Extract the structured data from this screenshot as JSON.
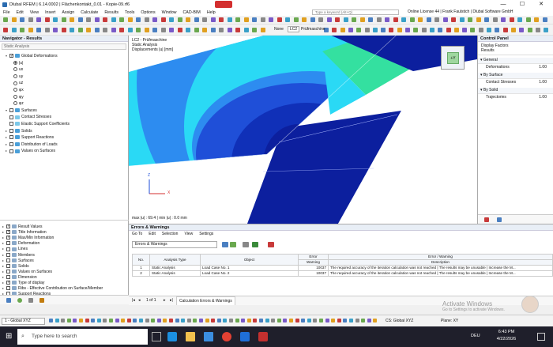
{
  "window": {
    "title": "Dlubal RFEM | 6.14.0002 | Flächenkontakt_0.01 - Kopie-09.rf6",
    "minimize": "—",
    "maximize": "☐",
    "close": "✕"
  },
  "menu": {
    "items": [
      "File",
      "Edit",
      "View",
      "Insert",
      "Assign",
      "Calculate",
      "Results",
      "Tools",
      "Options",
      "Window",
      "CAD-BIM",
      "Help"
    ],
    "search_placeholder": "Type a keyword (Alt+Q)",
    "license": "Online License 44 | Frank Faulstich | Dlubal Software GmbH"
  },
  "toolbar2": {
    "none_label": "None",
    "lc_label": "LC2",
    "lc_name": "Prüfmaschine"
  },
  "navigator": {
    "title": "Navigator - Results",
    "dropdown": "Static Analysis",
    "tree": [
      {
        "label": "Global Deformations",
        "indent": 1,
        "kind": "cb",
        "checked": true,
        "expand": "▾"
      },
      {
        "label": "|u|",
        "indent": 3,
        "kind": "rb",
        "checked": true
      },
      {
        "label": "ux",
        "indent": 3,
        "kind": "rb",
        "checked": false
      },
      {
        "label": "uy",
        "indent": 3,
        "kind": "rb",
        "checked": false
      },
      {
        "label": "uz",
        "indent": 3,
        "kind": "rb",
        "checked": false
      },
      {
        "label": "φx",
        "indent": 3,
        "kind": "rb",
        "checked": false
      },
      {
        "label": "φy",
        "indent": 3,
        "kind": "rb",
        "checked": false
      },
      {
        "label": "φz",
        "indent": 3,
        "kind": "rb",
        "checked": false
      },
      {
        "label": "Surfaces",
        "indent": 1,
        "kind": "cb",
        "checked": false,
        "expand": "▾"
      },
      {
        "label": "Contact Stresses",
        "indent": 2,
        "kind": "cb",
        "checked": false
      },
      {
        "label": "Elastic Support Coefficients",
        "indent": 2,
        "kind": "cb",
        "checked": false
      },
      {
        "label": "Solids",
        "indent": 1,
        "kind": "cb",
        "checked": false,
        "expand": "▸"
      },
      {
        "label": "Support Reactions",
        "indent": 1,
        "kind": "cb",
        "checked": false,
        "expand": "▸"
      },
      {
        "label": "Distribution of Loads",
        "indent": 1,
        "kind": "cb",
        "checked": false,
        "expand": "▸"
      },
      {
        "label": "Values on Surfaces",
        "indent": 1,
        "kind": "cb",
        "checked": false,
        "expand": "▸"
      }
    ],
    "tree2": [
      {
        "label": "Result Values",
        "checked": true
      },
      {
        "label": "Title Information",
        "checked": true
      },
      {
        "label": "Max/Min Information",
        "checked": true
      },
      {
        "label": "Deformation",
        "checked": false
      },
      {
        "label": "Lines",
        "checked": false
      },
      {
        "label": "Members",
        "checked": false
      },
      {
        "label": "Surfaces",
        "checked": false
      },
      {
        "label": "Solids",
        "checked": false
      },
      {
        "label": "Values on Surfaces",
        "checked": false
      },
      {
        "label": "Dimension",
        "checked": false
      },
      {
        "label": "Type of display",
        "checked": true
      },
      {
        "label": "Ribs - Effective Contribution on Surface/Member",
        "checked": false
      },
      {
        "label": "Support Reactions",
        "checked": false
      }
    ]
  },
  "viewport": {
    "line1": "LC2 - Prüfmaschine",
    "line2": "Static Analysis",
    "line3": "Displacements |u| [mm]",
    "maxmin": "max |u| : 69.4 | min |u| : 0.0 mm",
    "axis_x": "X",
    "axis_z": "Z",
    "navcube_label": "+Y"
  },
  "control_panel": {
    "title": "Control Panel",
    "subtitle1": "Display Factors",
    "subtitle2": "Results",
    "sections": [
      {
        "name": "General",
        "rows": [
          {
            "label": "Deformations",
            "value": "1.00"
          }
        ]
      },
      {
        "name": "By Surface",
        "rows": [
          {
            "label": "Contact Stresses",
            "value": "1.00"
          }
        ]
      },
      {
        "name": "By Solid",
        "rows": [
          {
            "label": "Trajectories",
            "value": "1.00"
          }
        ]
      }
    ]
  },
  "errors": {
    "title": "Errors & Warnings",
    "menu": [
      "Go To",
      "Edit",
      "Selection",
      "View",
      "Settings"
    ],
    "dropdown": "Errors & Warnings",
    "columns": {
      "no": "No.",
      "analysis": "Analysis Type",
      "object": "Object",
      "error_top": "Error",
      "error_bottom": "Warning",
      "desc_top": "Error / Warning",
      "desc_bottom": "Description"
    },
    "rows": [
      {
        "no": "1",
        "analysis": "Static Analysis",
        "object": "Load Case No. 1",
        "code": "10037",
        "desc": "The required accuracy of the iteration calculation was not reached | The results may be unusable | Increase the M..."
      },
      {
        "no": "2",
        "analysis": "Static Analysis",
        "object": "Load Case No. 2",
        "code": "10037",
        "desc": "The required accuracy of the iteration calculation was not reached | The results may be unusable | Increase the M..."
      }
    ],
    "pager": "1 of 1",
    "tab": "Calculation Errors & Warnings"
  },
  "watermark": {
    "line1": "Activate Windows",
    "line2": "Go to Settings to activate Windows."
  },
  "statusbar": {
    "view": "1 - Global XYZ",
    "cs": "CS: Global XYZ",
    "plane": "Plane: XY"
  },
  "taskbar": {
    "search_placeholder": "Type here to search",
    "language": "DEU",
    "time": "6:43 PM",
    "date": "4/22/2026"
  },
  "colors": {
    "navy": "#0c1f9e",
    "blue": "#1f4fd8",
    "mid": "#2d8cf0",
    "cyan": "#2ad9f5",
    "green": "#34e0a0",
    "accent": "#1b64c8"
  }
}
